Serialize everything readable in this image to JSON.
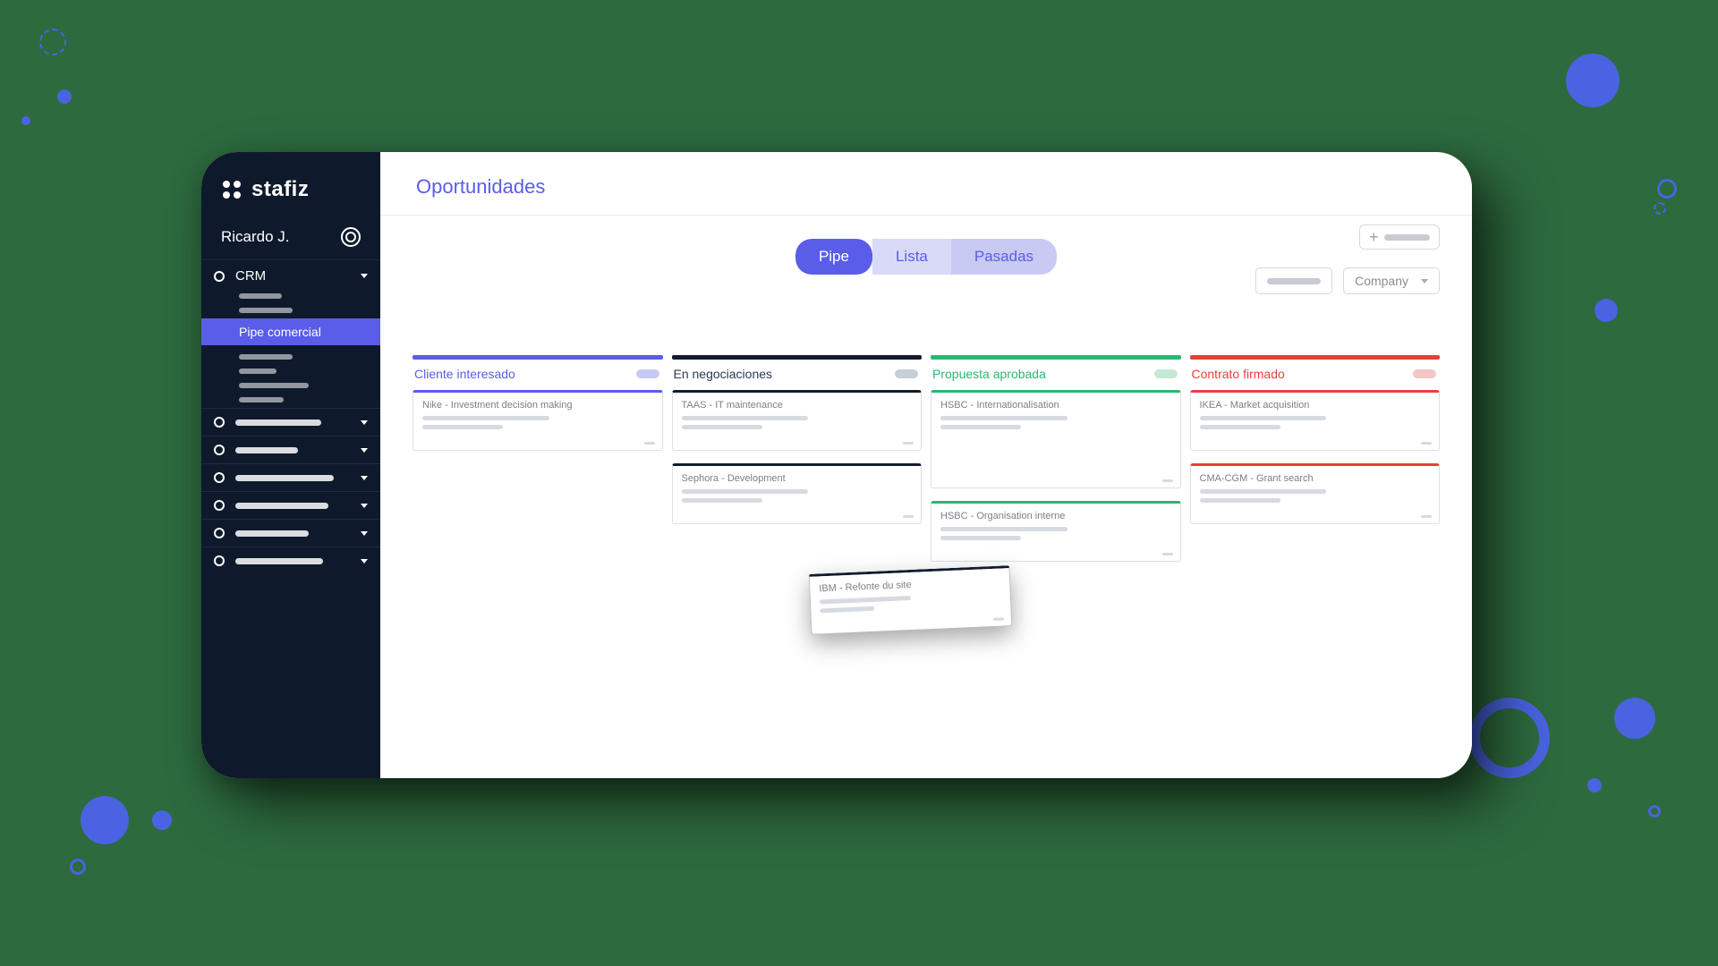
{
  "brand": {
    "name": "stafiz"
  },
  "user": {
    "name": "Ricardo J."
  },
  "sidebar": {
    "crm_label": "CRM",
    "active_item": "Pipe comercial"
  },
  "page": {
    "title": "Oportunidades"
  },
  "tabs": {
    "pipe": "Pipe",
    "lista": "Lista",
    "pasadas": "Pasadas"
  },
  "filters": {
    "company_label": "Company"
  },
  "columns": [
    {
      "id": "c1",
      "label": "Cliente interesado"
    },
    {
      "id": "c2",
      "label": "En negociaciones"
    },
    {
      "id": "c3",
      "label": "Propuesta aprobada"
    },
    {
      "id": "c4",
      "label": "Contrato firmado"
    }
  ],
  "cards": {
    "c1": [
      {
        "title": "Nike - Investment decision making"
      }
    ],
    "c2": [
      {
        "title": "TAAS - IT maintenance"
      },
      {
        "title": "Sephora - Development"
      }
    ],
    "c3": [
      {
        "title": "HSBC - Internationalisation"
      },
      {
        "title": "HSBC - Organisation interne"
      }
    ],
    "c4": [
      {
        "title": "IKEA - Market acquisition"
      },
      {
        "title": "CMA-CGM - Grant search"
      }
    ],
    "dragging": {
      "title": "IBM - Refonte du site"
    }
  }
}
